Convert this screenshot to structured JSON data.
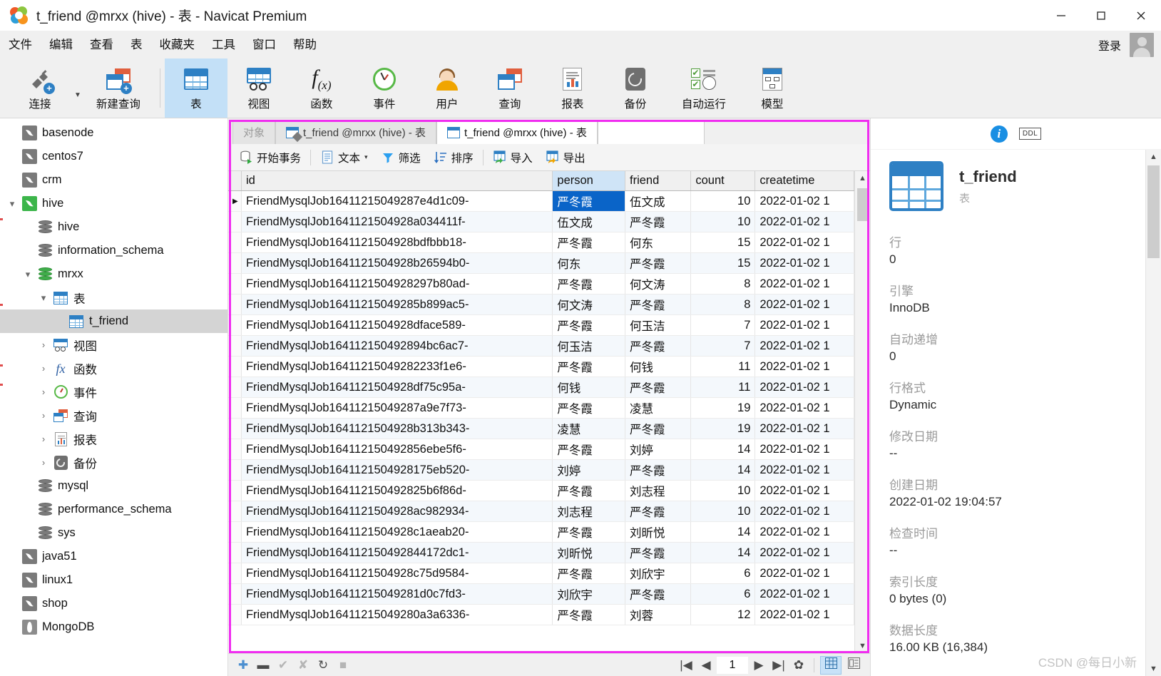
{
  "window": {
    "title": "t_friend @mrxx (hive) - 表 - Navicat Premium",
    "minimize": "—",
    "maximize": "▢",
    "close": "✕"
  },
  "menu": {
    "items": [
      "文件",
      "编辑",
      "查看",
      "表",
      "收藏夹",
      "工具",
      "窗口",
      "帮助"
    ],
    "login_label": "登录"
  },
  "toolbar": {
    "items": [
      {
        "label": "连接",
        "icon": "connection-icon"
      },
      {
        "label": "新建查询",
        "icon": "new-query-icon"
      },
      {
        "label": "表",
        "icon": "table-icon",
        "active": true
      },
      {
        "label": "视图",
        "icon": "view-icon"
      },
      {
        "label": "函数",
        "icon": "function-icon"
      },
      {
        "label": "事件",
        "icon": "event-icon"
      },
      {
        "label": "用户",
        "icon": "user-icon"
      },
      {
        "label": "查询",
        "icon": "query-icon"
      },
      {
        "label": "报表",
        "icon": "report-icon"
      },
      {
        "label": "备份",
        "icon": "backup-icon"
      },
      {
        "label": "自动运行",
        "icon": "automation-icon"
      },
      {
        "label": "模型",
        "icon": "model-icon"
      }
    ]
  },
  "sidebar": {
    "nodes": [
      {
        "label": "basenode",
        "icon": "mysql-connection-icon",
        "indent": 0,
        "twisty": ""
      },
      {
        "label": "centos7",
        "icon": "mysql-connection-icon",
        "indent": 0,
        "twisty": ""
      },
      {
        "label": "crm",
        "icon": "mysql-connection-icon",
        "indent": 0,
        "twisty": ""
      },
      {
        "label": "hive",
        "icon": "mysql-connection-icon-green",
        "indent": 0,
        "twisty": "▾"
      },
      {
        "label": "hive",
        "icon": "database-icon",
        "indent": 1,
        "twisty": ""
      },
      {
        "label": "information_schema",
        "icon": "database-icon",
        "indent": 1,
        "twisty": ""
      },
      {
        "label": "mrxx",
        "icon": "database-icon-green",
        "indent": 1,
        "twisty": "▾"
      },
      {
        "label": "表",
        "icon": "table-icon",
        "indent": 2,
        "twisty": "▾"
      },
      {
        "label": "t_friend",
        "icon": "table-icon",
        "indent": 3,
        "twisty": "",
        "selected": true
      },
      {
        "label": "视图",
        "icon": "view-icon",
        "indent": 2,
        "twisty": "›"
      },
      {
        "label": "函数",
        "icon": "function-icon",
        "indent": 2,
        "twisty": "›"
      },
      {
        "label": "事件",
        "icon": "event-icon",
        "indent": 2,
        "twisty": "›"
      },
      {
        "label": "查询",
        "icon": "query-icon",
        "indent": 2,
        "twisty": "›"
      },
      {
        "label": "报表",
        "icon": "report-icon",
        "indent": 2,
        "twisty": "›"
      },
      {
        "label": "备份",
        "icon": "backup-icon",
        "indent": 2,
        "twisty": "›"
      },
      {
        "label": "mysql",
        "icon": "database-icon",
        "indent": 1,
        "twisty": ""
      },
      {
        "label": "performance_schema",
        "icon": "database-icon",
        "indent": 1,
        "twisty": ""
      },
      {
        "label": "sys",
        "icon": "database-icon",
        "indent": 1,
        "twisty": ""
      },
      {
        "label": "java51",
        "icon": "mysql-connection-icon",
        "indent": 0,
        "twisty": ""
      },
      {
        "label": "linux1",
        "icon": "mysql-connection-icon",
        "indent": 0,
        "twisty": ""
      },
      {
        "label": "shop",
        "icon": "mysql-connection-icon",
        "indent": 0,
        "twisty": ""
      },
      {
        "label": "MongoDB",
        "icon": "mongodb-connection-icon",
        "indent": 0,
        "twisty": ""
      }
    ]
  },
  "tabs": [
    {
      "label": "对象",
      "icon": "",
      "kind": "object"
    },
    {
      "label": "t_friend @mrxx (hive) - 表",
      "icon": "table-design-icon",
      "kind": "design"
    },
    {
      "label": "t_friend @mrxx (hive) - 表",
      "icon": "table-data-icon",
      "kind": "data",
      "active": true
    }
  ],
  "grid_toolbar": [
    {
      "label": "开始事务",
      "icon": "transaction-icon"
    },
    {
      "label": "文本",
      "icon": "text-icon",
      "caret": "▾"
    },
    {
      "label": "筛选",
      "icon": "filter-icon"
    },
    {
      "label": "排序",
      "icon": "sort-icon"
    },
    {
      "label": "导入",
      "icon": "import-icon"
    },
    {
      "label": "导出",
      "icon": "export-icon"
    }
  ],
  "grid": {
    "columns": [
      "id",
      "person",
      "friend",
      "count",
      "createtime"
    ],
    "selected_column": "person",
    "selected_cell": {
      "row": 0,
      "column": "person"
    },
    "rows": [
      {
        "marker": "▶",
        "id": "FriendMysqlJob16411215049287e4d1c09-",
        "person": "严冬霞",
        "friend": "伍文成",
        "count": "10",
        "createtime": "2022-01-02 1"
      },
      {
        "marker": "",
        "id": "FriendMysqlJob1641121504928a034411f-",
        "person": "伍文成",
        "friend": "严冬霞",
        "count": "10",
        "createtime": "2022-01-02 1"
      },
      {
        "marker": "",
        "id": "FriendMysqlJob1641121504928bdfbbb18-",
        "person": "严冬霞",
        "friend": "何东",
        "count": "15",
        "createtime": "2022-01-02 1"
      },
      {
        "marker": "",
        "id": "FriendMysqlJob1641121504928b26594b0-",
        "person": "何东",
        "friend": "严冬霞",
        "count": "15",
        "createtime": "2022-01-02 1"
      },
      {
        "marker": "",
        "id": "FriendMysqlJob1641121504928297b80ad-",
        "person": "严冬霞",
        "friend": "何文涛",
        "count": "8",
        "createtime": "2022-01-02 1"
      },
      {
        "marker": "",
        "id": "FriendMysqlJob16411215049285b899ac5-",
        "person": "何文涛",
        "friend": "严冬霞",
        "count": "8",
        "createtime": "2022-01-02 1"
      },
      {
        "marker": "",
        "id": "FriendMysqlJob1641121504928dface589-",
        "person": "严冬霞",
        "friend": "何玉洁",
        "count": "7",
        "createtime": "2022-01-02 1"
      },
      {
        "marker": "",
        "id": "FriendMysqlJob164112150492894bc6ac7-",
        "person": "何玉洁",
        "friend": "严冬霞",
        "count": "7",
        "createtime": "2022-01-02 1"
      },
      {
        "marker": "",
        "id": "FriendMysqlJob16411215049282233f1e6-",
        "person": "严冬霞",
        "friend": "何钱",
        "count": "11",
        "createtime": "2022-01-02 1"
      },
      {
        "marker": "",
        "id": "FriendMysqlJob1641121504928df75c95a-",
        "person": "何钱",
        "friend": "严冬霞",
        "count": "11",
        "createtime": "2022-01-02 1"
      },
      {
        "marker": "",
        "id": "FriendMysqlJob16411215049287a9e7f73-",
        "person": "严冬霞",
        "friend": "凌慧",
        "count": "19",
        "createtime": "2022-01-02 1"
      },
      {
        "marker": "",
        "id": "FriendMysqlJob1641121504928b313b343-",
        "person": "凌慧",
        "friend": "严冬霞",
        "count": "19",
        "createtime": "2022-01-02 1"
      },
      {
        "marker": "",
        "id": "FriendMysqlJob164112150492856ebe5f6-",
        "person": "严冬霞",
        "friend": "刘婷",
        "count": "14",
        "createtime": "2022-01-02 1"
      },
      {
        "marker": "",
        "id": "FriendMysqlJob1641121504928175eb520-",
        "person": "刘婷",
        "friend": "严冬霞",
        "count": "14",
        "createtime": "2022-01-02 1"
      },
      {
        "marker": "",
        "id": "FriendMysqlJob164112150492825b6f86d-",
        "person": "严冬霞",
        "friend": "刘志程",
        "count": "10",
        "createtime": "2022-01-02 1"
      },
      {
        "marker": "",
        "id": "FriendMysqlJob1641121504928ac982934-",
        "person": "刘志程",
        "friend": "严冬霞",
        "count": "10",
        "createtime": "2022-01-02 1"
      },
      {
        "marker": "",
        "id": "FriendMysqlJob1641121504928c1aeab20-",
        "person": "严冬霞",
        "friend": "刘昕悦",
        "count": "14",
        "createtime": "2022-01-02 1"
      },
      {
        "marker": "",
        "id": "FriendMysqlJob164112150492844172dc1-",
        "person": "刘昕悦",
        "friend": "严冬霞",
        "count": "14",
        "createtime": "2022-01-02 1"
      },
      {
        "marker": "",
        "id": "FriendMysqlJob1641121504928c75d9584-",
        "person": "严冬霞",
        "friend": "刘欣宇",
        "count": "6",
        "createtime": "2022-01-02 1"
      },
      {
        "marker": "",
        "id": "FriendMysqlJob16411215049281d0c7fd3-",
        "person": "刘欣宇",
        "friend": "严冬霞",
        "count": "6",
        "createtime": "2022-01-02 1"
      },
      {
        "marker": "",
        "id": "FriendMysqlJob16411215049280a3a6336-",
        "person": "严冬霞",
        "friend": "刘蓉",
        "count": "12",
        "createtime": "2022-01-02 1"
      }
    ]
  },
  "statusbar": {
    "add": "✚",
    "remove": "▬",
    "confirm": "✔",
    "cancel": "✘",
    "refresh": "↻",
    "stop": "■",
    "first": "|◀",
    "prev": "◀",
    "page": "1",
    "next": "▶",
    "last": "▶|",
    "settings": "✿",
    "grid_view": "grid-view-icon",
    "form_view": "form-view-icon"
  },
  "info_panel": {
    "info_tab": "i",
    "ddl_tab": "DDL",
    "object_name": "t_friend",
    "object_type": "表",
    "fields": [
      {
        "key": "行",
        "value": "0"
      },
      {
        "key": "引擎",
        "value": "InnoDB"
      },
      {
        "key": "自动递增",
        "value": "0"
      },
      {
        "key": "行格式",
        "value": "Dynamic"
      },
      {
        "key": "修改日期",
        "value": "--"
      },
      {
        "key": "创建日期",
        "value": "2022-01-02 19:04:57"
      },
      {
        "key": "检查时间",
        "value": "--"
      },
      {
        "key": "索引长度",
        "value": "0 bytes (0)"
      },
      {
        "key": "数据长度",
        "value": "16.00 KB (16,384)"
      }
    ]
  },
  "watermark": "CSDN @每日小新",
  "colors": {
    "accent": "#2e80c4",
    "highlight": "#0a64c8",
    "frame": "#f02df0",
    "toolbar_active": "#c3e0f7"
  }
}
